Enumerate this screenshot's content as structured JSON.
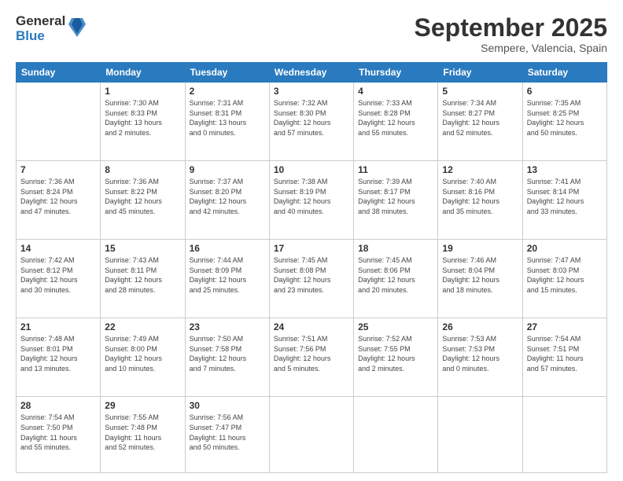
{
  "logo": {
    "general": "General",
    "blue": "Blue"
  },
  "title": {
    "month": "September 2025",
    "location": "Sempere, Valencia, Spain"
  },
  "weekdays": [
    "Sunday",
    "Monday",
    "Tuesday",
    "Wednesday",
    "Thursday",
    "Friday",
    "Saturday"
  ],
  "weeks": [
    [
      {
        "day": "",
        "info": ""
      },
      {
        "day": "1",
        "info": "Sunrise: 7:30 AM\nSunset: 8:33 PM\nDaylight: 13 hours\nand 2 minutes."
      },
      {
        "day": "2",
        "info": "Sunrise: 7:31 AM\nSunset: 8:31 PM\nDaylight: 13 hours\nand 0 minutes."
      },
      {
        "day": "3",
        "info": "Sunrise: 7:32 AM\nSunset: 8:30 PM\nDaylight: 12 hours\nand 57 minutes."
      },
      {
        "day": "4",
        "info": "Sunrise: 7:33 AM\nSunset: 8:28 PM\nDaylight: 12 hours\nand 55 minutes."
      },
      {
        "day": "5",
        "info": "Sunrise: 7:34 AM\nSunset: 8:27 PM\nDaylight: 12 hours\nand 52 minutes."
      },
      {
        "day": "6",
        "info": "Sunrise: 7:35 AM\nSunset: 8:25 PM\nDaylight: 12 hours\nand 50 minutes."
      }
    ],
    [
      {
        "day": "7",
        "info": "Sunrise: 7:36 AM\nSunset: 8:24 PM\nDaylight: 12 hours\nand 47 minutes."
      },
      {
        "day": "8",
        "info": "Sunrise: 7:36 AM\nSunset: 8:22 PM\nDaylight: 12 hours\nand 45 minutes."
      },
      {
        "day": "9",
        "info": "Sunrise: 7:37 AM\nSunset: 8:20 PM\nDaylight: 12 hours\nand 42 minutes."
      },
      {
        "day": "10",
        "info": "Sunrise: 7:38 AM\nSunset: 8:19 PM\nDaylight: 12 hours\nand 40 minutes."
      },
      {
        "day": "11",
        "info": "Sunrise: 7:39 AM\nSunset: 8:17 PM\nDaylight: 12 hours\nand 38 minutes."
      },
      {
        "day": "12",
        "info": "Sunrise: 7:40 AM\nSunset: 8:16 PM\nDaylight: 12 hours\nand 35 minutes."
      },
      {
        "day": "13",
        "info": "Sunrise: 7:41 AM\nSunset: 8:14 PM\nDaylight: 12 hours\nand 33 minutes."
      }
    ],
    [
      {
        "day": "14",
        "info": "Sunrise: 7:42 AM\nSunset: 8:12 PM\nDaylight: 12 hours\nand 30 minutes."
      },
      {
        "day": "15",
        "info": "Sunrise: 7:43 AM\nSunset: 8:11 PM\nDaylight: 12 hours\nand 28 minutes."
      },
      {
        "day": "16",
        "info": "Sunrise: 7:44 AM\nSunset: 8:09 PM\nDaylight: 12 hours\nand 25 minutes."
      },
      {
        "day": "17",
        "info": "Sunrise: 7:45 AM\nSunset: 8:08 PM\nDaylight: 12 hours\nand 23 minutes."
      },
      {
        "day": "18",
        "info": "Sunrise: 7:45 AM\nSunset: 8:06 PM\nDaylight: 12 hours\nand 20 minutes."
      },
      {
        "day": "19",
        "info": "Sunrise: 7:46 AM\nSunset: 8:04 PM\nDaylight: 12 hours\nand 18 minutes."
      },
      {
        "day": "20",
        "info": "Sunrise: 7:47 AM\nSunset: 8:03 PM\nDaylight: 12 hours\nand 15 minutes."
      }
    ],
    [
      {
        "day": "21",
        "info": "Sunrise: 7:48 AM\nSunset: 8:01 PM\nDaylight: 12 hours\nand 13 minutes."
      },
      {
        "day": "22",
        "info": "Sunrise: 7:49 AM\nSunset: 8:00 PM\nDaylight: 12 hours\nand 10 minutes."
      },
      {
        "day": "23",
        "info": "Sunrise: 7:50 AM\nSunset: 7:58 PM\nDaylight: 12 hours\nand 7 minutes."
      },
      {
        "day": "24",
        "info": "Sunrise: 7:51 AM\nSunset: 7:56 PM\nDaylight: 12 hours\nand 5 minutes."
      },
      {
        "day": "25",
        "info": "Sunrise: 7:52 AM\nSunset: 7:55 PM\nDaylight: 12 hours\nand 2 minutes."
      },
      {
        "day": "26",
        "info": "Sunrise: 7:53 AM\nSunset: 7:53 PM\nDaylight: 12 hours\nand 0 minutes."
      },
      {
        "day": "27",
        "info": "Sunrise: 7:54 AM\nSunset: 7:51 PM\nDaylight: 11 hours\nand 57 minutes."
      }
    ],
    [
      {
        "day": "28",
        "info": "Sunrise: 7:54 AM\nSunset: 7:50 PM\nDaylight: 11 hours\nand 55 minutes."
      },
      {
        "day": "29",
        "info": "Sunrise: 7:55 AM\nSunset: 7:48 PM\nDaylight: 11 hours\nand 52 minutes."
      },
      {
        "day": "30",
        "info": "Sunrise: 7:56 AM\nSunset: 7:47 PM\nDaylight: 11 hours\nand 50 minutes."
      },
      {
        "day": "",
        "info": ""
      },
      {
        "day": "",
        "info": ""
      },
      {
        "day": "",
        "info": ""
      },
      {
        "day": "",
        "info": ""
      }
    ]
  ]
}
